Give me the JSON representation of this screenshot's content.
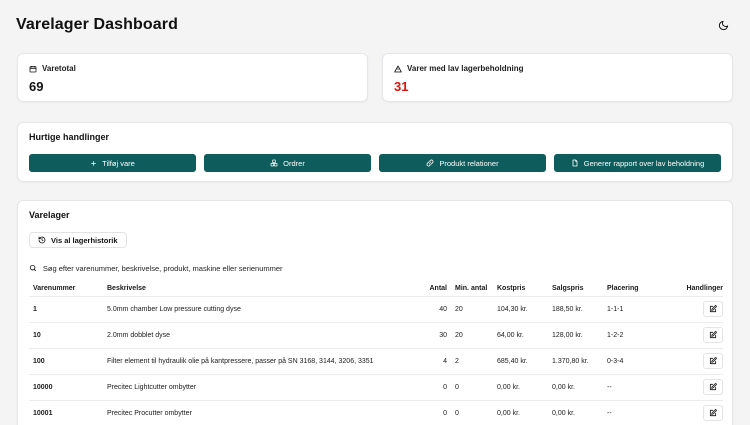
{
  "header": {
    "title": "Varelager Dashboard"
  },
  "stats": {
    "total": {
      "label": "Varetotal",
      "value": "69"
    },
    "low_stock": {
      "label": "Varer med lav lagerbeholdning",
      "value": "31"
    }
  },
  "quick_actions": {
    "title": "Hurtige handlinger",
    "buttons": [
      {
        "label": "Tilføj vare",
        "icon": "plus-icon"
      },
      {
        "label": "Ordrer",
        "icon": "boxes-icon"
      },
      {
        "label": "Produkt relationer",
        "icon": "link-icon"
      },
      {
        "label": "Generer rapport over lav beholdning",
        "icon": "file-icon"
      }
    ]
  },
  "inventory": {
    "title": "Varelager",
    "history_button": "Vis al lagerhistorik",
    "search_placeholder": "Søg efter varenummer, beskrivelse, produkt, maskine eller serienummer",
    "columns": [
      "Varenummer",
      "Beskrivelse",
      "Antal",
      "Min. antal",
      "Kostpris",
      "Salgspris",
      "Placering",
      "Handlinger"
    ],
    "rows": [
      {
        "varenummer": "1",
        "beskrivelse": "5.0mm chamber Low pressure cutting dyse",
        "antal": "40",
        "min": "20",
        "kostpris": "104,30 kr.",
        "salgspris": "188,50 kr.",
        "placering": "1-1-1"
      },
      {
        "varenummer": "10",
        "beskrivelse": "2.0mm dobblet dyse",
        "antal": "30",
        "min": "20",
        "kostpris": "64,00 kr.",
        "salgspris": "128,00 kr.",
        "placering": "1-2-2"
      },
      {
        "varenummer": "100",
        "beskrivelse": "Filter element til hydraulik olie på kantpressere, passer på SN 3168, 3144, 3206, 3351",
        "antal": "4",
        "min": "2",
        "kostpris": "685,40 kr.",
        "salgspris": "1.370,80 kr.",
        "placering": "0-3-4"
      },
      {
        "varenummer": "10000",
        "beskrivelse": "Precitec Lightcutter ombytter",
        "antal": "0",
        "min": "0",
        "kostpris": "0,00 kr.",
        "salgspris": "0,00 kr.",
        "placering": "--"
      },
      {
        "varenummer": "10001",
        "beskrivelse": "Precitec Procutter ombytter",
        "antal": "0",
        "min": "0",
        "kostpris": "0,00 kr.",
        "salgspris": "0,00 kr.",
        "placering": "--"
      }
    ]
  },
  "colors": {
    "accent": "#0f5c5c",
    "warning": "#d4180f"
  }
}
